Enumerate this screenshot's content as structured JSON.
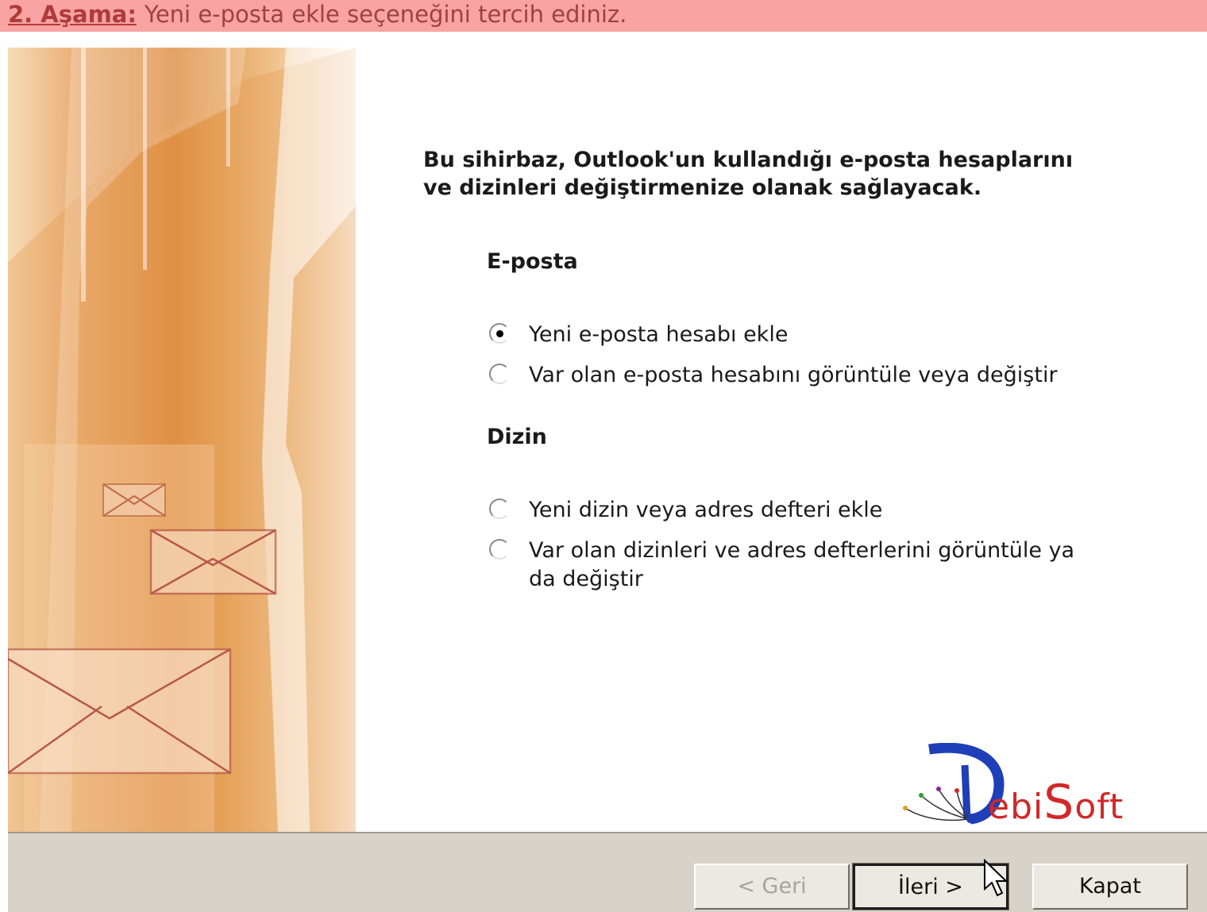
{
  "banner": {
    "step_label": "2. Aşama:",
    "instruction": "Yeni e-posta ekle seçeneğini tercih ediniz."
  },
  "dialog": {
    "intro_line1": "Bu sihirbaz, Outlook'un kullandığı e-posta hesaplarını",
    "intro_line2": "ve dizinleri değiştirmenize olanak sağlayacak.",
    "email_section": {
      "title": "E-posta",
      "options": [
        {
          "label": "Yeni e-posta hesabı ekle",
          "selected": true
        },
        {
          "label": "Var olan e-posta hesabını görüntüle veya değiştir",
          "selected": false
        }
      ]
    },
    "directory_section": {
      "title": "Dizin",
      "options": [
        {
          "label": "Yeni dizin veya adres defteri ekle",
          "selected": false
        },
        {
          "label": "Var olan dizinleri ve adres defterlerini görüntüle ya da değiştir",
          "selected": false
        }
      ]
    },
    "buttons": {
      "back": "< Geri",
      "next": "İleri >",
      "close": "Kapat"
    }
  },
  "logo": {
    "text_d": "D",
    "text_ebi": "ebi",
    "text_s": "S",
    "text_oft": "oft"
  },
  "colors": {
    "banner_bg": "#f9a3a3",
    "banner_text": "#a04040",
    "logo_red": "#d12828",
    "logo_blue": "#1f3fb8",
    "button_bar": "#d7d3c9"
  }
}
